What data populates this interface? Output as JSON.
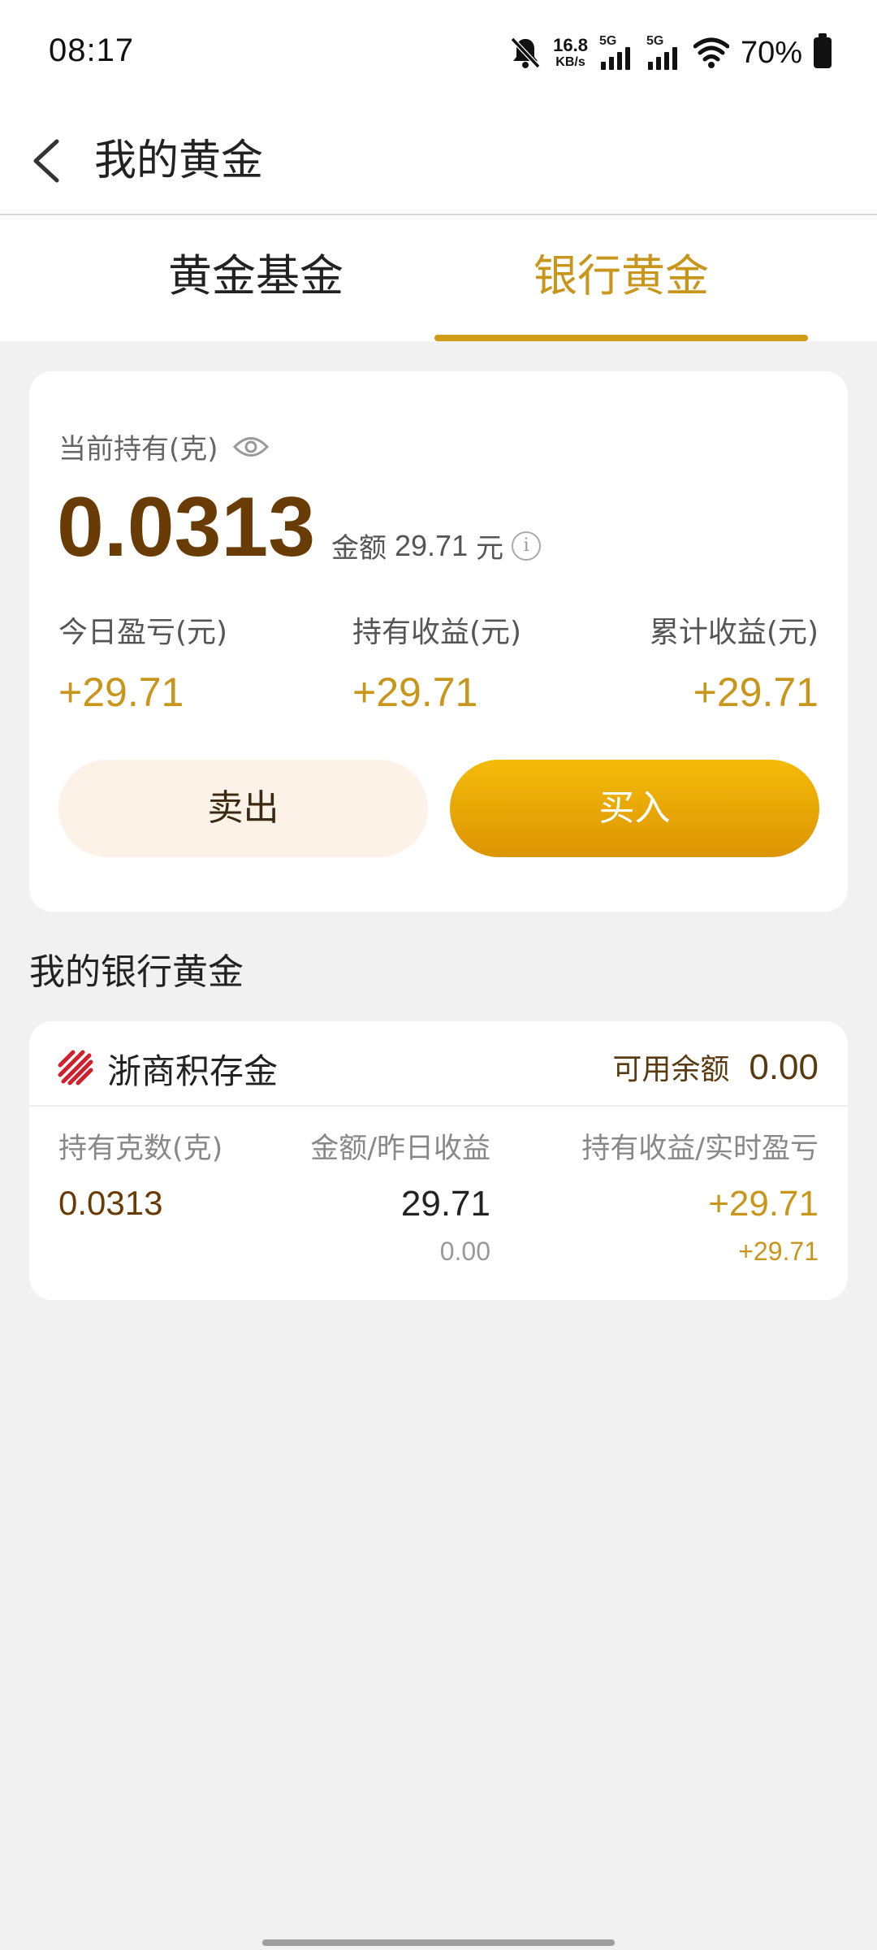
{
  "status_bar": {
    "time": "08:17",
    "net_speed_value": "16.8",
    "net_speed_unit": "KB/s",
    "signal1_label": "5G",
    "signal2_label": "5G",
    "battery_percent": "70%",
    "icons": [
      "bell-muted-icon",
      "signal-icon",
      "signal-icon",
      "wifi-icon",
      "battery-icon"
    ]
  },
  "header": {
    "title": "我的黄金",
    "back_icon": "chevron-left-icon"
  },
  "tabs": [
    {
      "label": "黄金基金",
      "active": false
    },
    {
      "label": "银行黄金",
      "active": true
    }
  ],
  "holdings": {
    "label": "当前持有(克)",
    "grams": "0.0313",
    "amount_prefix": "金额",
    "amount_value": "29.71",
    "amount_unit": "元",
    "stats": [
      {
        "label": "今日盈亏(元)",
        "value": "+29.71"
      },
      {
        "label": "持有收益(元)",
        "value": "+29.71"
      },
      {
        "label": "累计收益(元)",
        "value": "+29.71"
      }
    ],
    "sell_label": "卖出",
    "buy_label": "买入"
  },
  "section_title": "我的银行黄金",
  "bank_gold": {
    "name": "浙商积存金",
    "available_label": "可用余额",
    "available_value": "0.00",
    "columns": [
      "持有克数(克)",
      "金额/昨日收益",
      "持有收益/实时盈亏"
    ],
    "grams": "0.0313",
    "amount": "29.71",
    "yesterday_income": "0.00",
    "holding_income": "+29.71",
    "realtime_pl": "+29.71"
  },
  "colors": {
    "accent_gold": "#c9961c",
    "dark_brown": "#6a3c05",
    "buy_button": "#e9a706"
  }
}
